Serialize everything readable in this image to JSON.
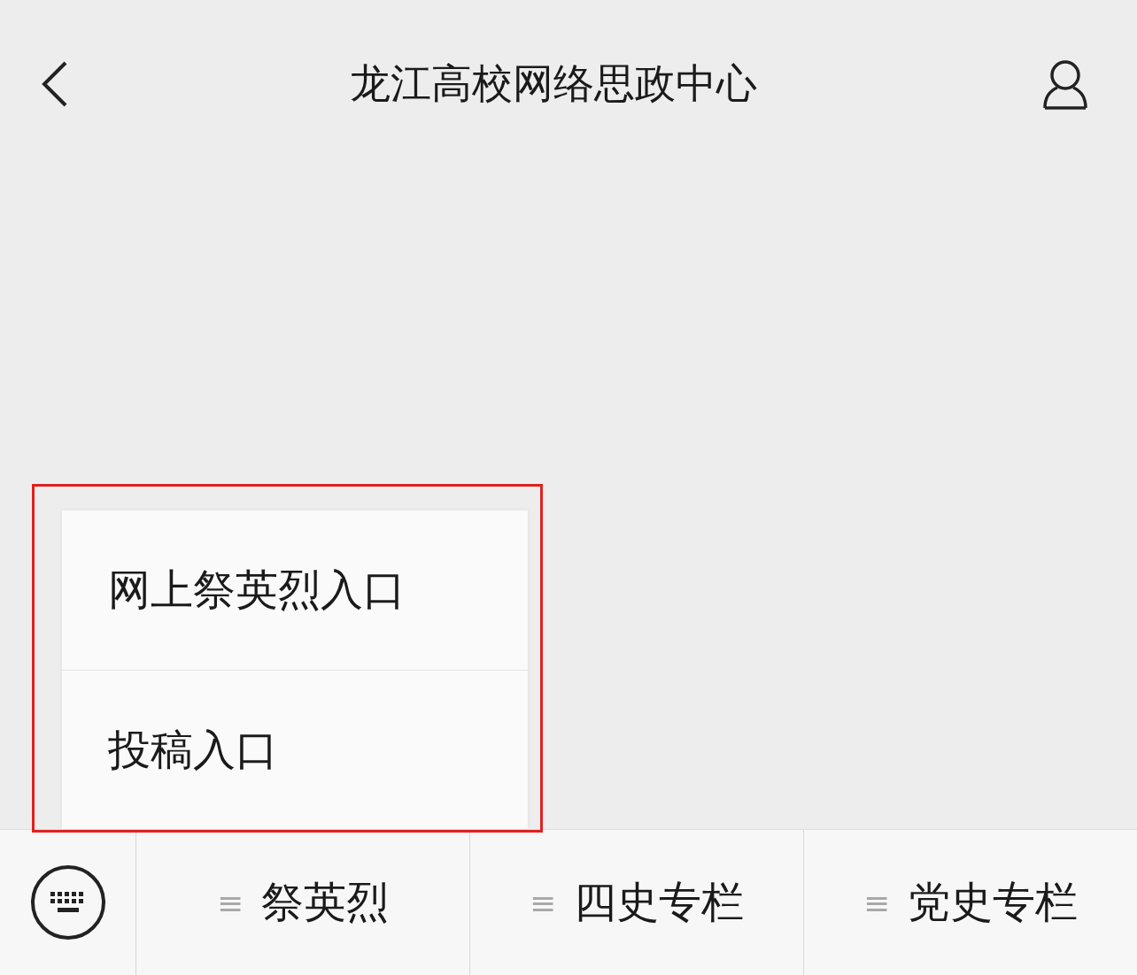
{
  "header": {
    "title": "龙江高校网络思政中心"
  },
  "popup_menu": {
    "highlighted": true,
    "items": [
      {
        "label": "网上祭英烈入口"
      },
      {
        "label": "投稿入口"
      }
    ]
  },
  "bottom_menu": {
    "items": [
      {
        "icon": "≡",
        "label": "祭英烈"
      },
      {
        "icon": "≡",
        "label": "四史专栏"
      },
      {
        "icon": "≡",
        "label": "党史专栏"
      }
    ]
  }
}
